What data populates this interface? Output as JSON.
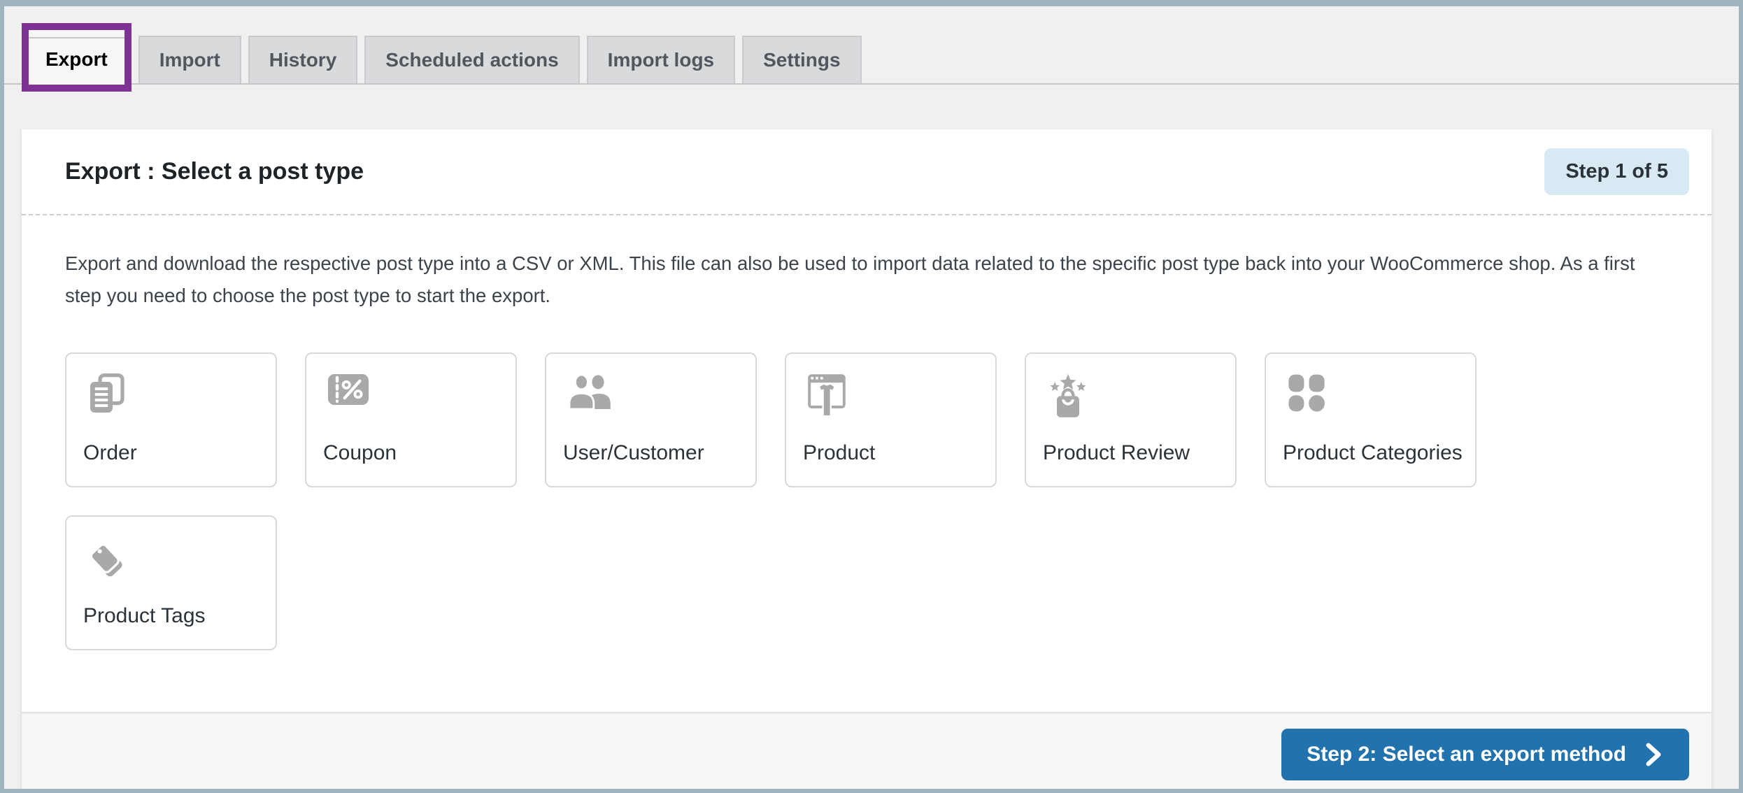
{
  "tabs": {
    "items": [
      {
        "label": "Export",
        "active": true
      },
      {
        "label": "Import",
        "active": false
      },
      {
        "label": "History",
        "active": false
      },
      {
        "label": "Scheduled actions",
        "active": false
      },
      {
        "label": "Import logs",
        "active": false
      },
      {
        "label": "Settings",
        "active": false
      }
    ]
  },
  "panel": {
    "title": "Export : Select a post type",
    "step_badge": "Step 1 of 5",
    "description": "Export and download the respective post type into a CSV or XML. This file can also be used to import data related to the specific post type back into your WooCommerce shop. As a first step you need to choose the post type to start the export.",
    "post_types": [
      {
        "label": "Order",
        "icon": "order-documents-icon"
      },
      {
        "label": "Coupon",
        "icon": "coupon-icon"
      },
      {
        "label": "User/Customer",
        "icon": "user-customer-icon"
      },
      {
        "label": "Product",
        "icon": "product-icon"
      },
      {
        "label": "Product Review",
        "icon": "product-review-icon"
      },
      {
        "label": "Product Categories",
        "icon": "product-categories-icon"
      },
      {
        "label": "Product Tags",
        "icon": "product-tags-icon"
      }
    ],
    "footer": {
      "next_button_label": "Step 2: Select an export method",
      "next_button_chevron": "chevron-right-icon"
    }
  },
  "colors": {
    "frame_border": "#9fb4c1",
    "page_background": "#f0f0f1",
    "highlight_purple": "#7d3294",
    "badge_background": "#d7e9f3",
    "button_blue": "#2272ae",
    "icon_gray": "#a9a9a9"
  }
}
